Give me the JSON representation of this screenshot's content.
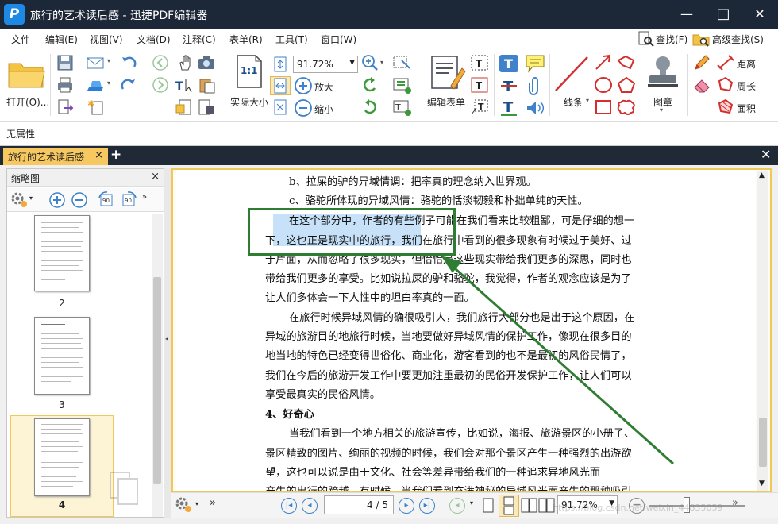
{
  "app": {
    "title": "旅行的艺术读后感 - 迅捷PDF编辑器",
    "logo_letter": "P",
    "min_glyph": "—",
    "max_glyph": "□",
    "close_glyph": "✕"
  },
  "menu": [
    "文件",
    "编辑(E)",
    "视图(V)",
    "文档(D)",
    "注释(C)",
    "表单(R)",
    "工具(T)",
    "窗口(W)"
  ],
  "search": {
    "find_label": "查找(F)",
    "adv_find_label": "高级查找(S)"
  },
  "ribbon": {
    "open_label": "打开(O)...",
    "zoom_value": "91.72%",
    "actual_size_label": "实际大小",
    "zoom_in_label": "放大",
    "zoom_out_label": "缩小",
    "edit_form_label": "编辑表单",
    "line_label": "线条",
    "stamp_label": "图章",
    "distance_label": "距离",
    "perimeter_label": "周长",
    "area_label": "面积",
    "actual_size_icon_text": "1:1"
  },
  "properties": {
    "label": "无属性"
  },
  "tab": {
    "label": "旅行的艺术读后感",
    "close_glyph": "×",
    "add_glyph": "+"
  },
  "sidebar": {
    "title": "缩略图",
    "close_glyph": "×",
    "thumbnails": [
      {
        "page": "2"
      },
      {
        "page": "3"
      },
      {
        "page": "4",
        "selected": true
      }
    ]
  },
  "document": {
    "lines": [
      "b、拉屎的驴的异域情调：把率真的理念纳入世界观。",
      "c、骆驼所体现的异域风情：骆驼的恬淡韧毅和朴拙单纯的天性。",
      "在这个部分中，作者的有些例子可能在我们看来比较粗鄙，可是仔细的想一",
      "下，这也正是现实中的旅行，我们在旅行中看到的很多现象有时候过于美好、过",
      "于片面，从而忽略了很多现实，但恰恰是这些现实带给我们更多的深思，同时也",
      "带给我们更多的享受。比如说拉屎的驴和骆驼，我觉得，作者的观念应该是为了",
      "让人们多体会一下人性中的坦白率真的一面。",
      "在旅行时候异域风情的确很吸引人，我们旅行大部分也是出于这个原因，在",
      "异域的旅游目的地旅行时候，当地要做好异域风情的保护工作，像现在很多目的",
      "地当地的特色已经变得世俗化、商业化，游客看到的也不是最初的风俗民情了，",
      "我们在今后的旅游开发工作中要更加注重最初的民俗开发保护工作，让人们可以",
      "享受最真实的民俗风情。",
      "4、好奇心",
      "当我们看到一个地方相关的旅游宣传，比如说，海报、旅游景区的小册子、",
      "景区精致的图片、绚丽的视频的时候，我们会对那个景区产生一种强烈的出游欲",
      "望，这也可以说是由于文化、社会等差异带给我们的一种追求异地风光而",
      "产生的出行的跨越。有时候，当我们看到充满神秘的异域风光而产生的那种吸引"
    ]
  },
  "statusbar": {
    "page_value": "4",
    "page_total": "5",
    "page_sep": "/",
    "zoom_value": "91.72%",
    "watermark": "https://blog.csdn.net/weixin_44835059"
  },
  "colors": {
    "titlebar": "#1c2737",
    "tab_active": "#f6c85f",
    "annotation_box": "#2e7d32",
    "highlight": "#a9d1f5",
    "accent_blue": "#3f82c9"
  }
}
